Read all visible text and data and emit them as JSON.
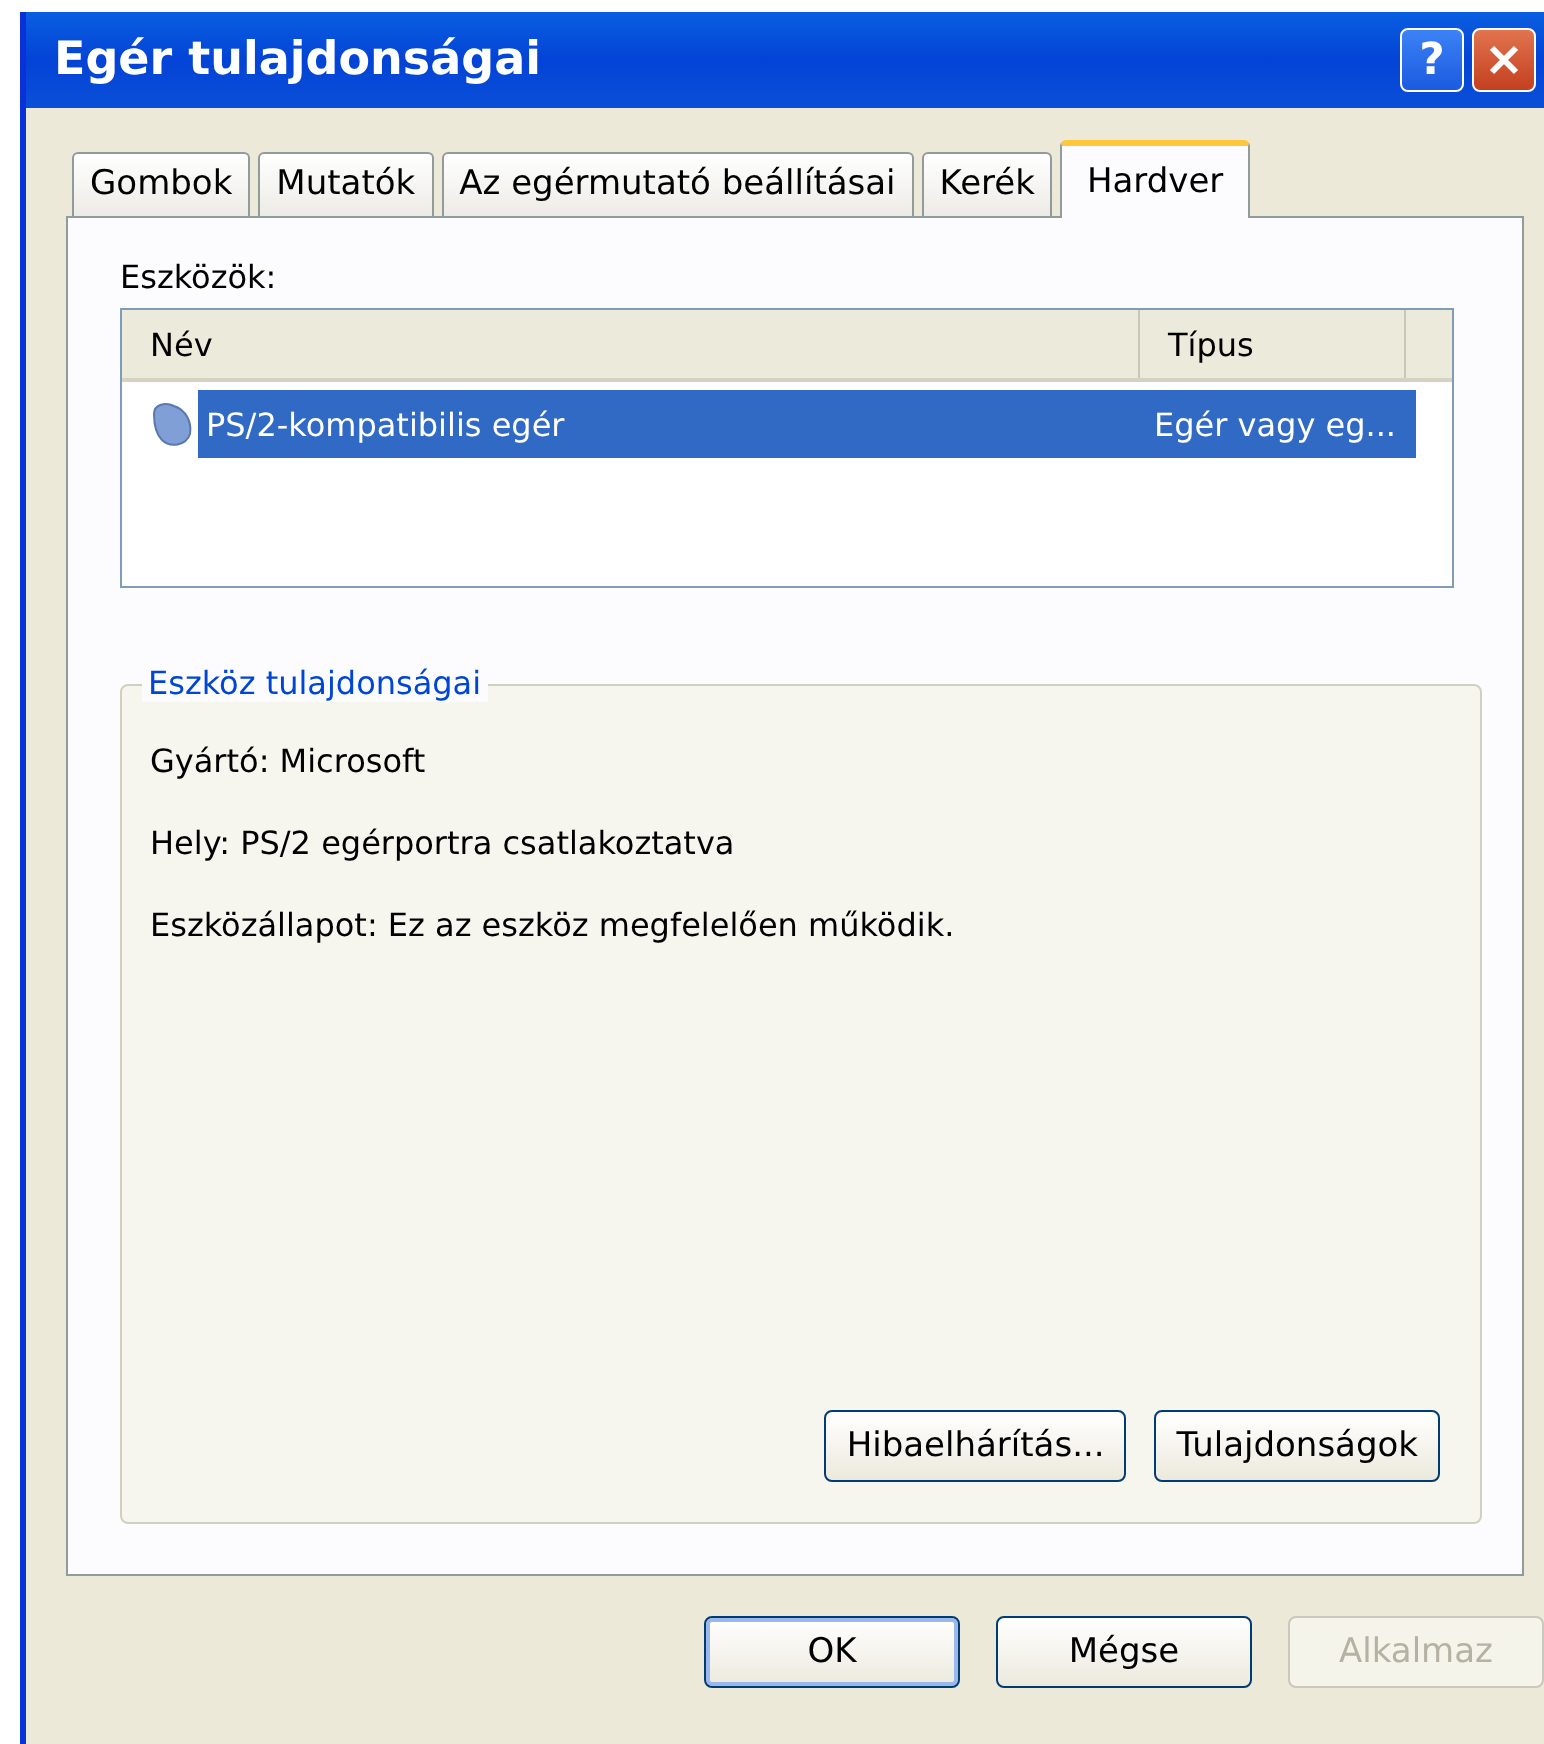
{
  "window": {
    "title": "Egér tulajdonságai",
    "help_button": "?"
  },
  "tabs": [
    {
      "label": "Gombok",
      "selected": false
    },
    {
      "label": "Mutatók",
      "selected": false
    },
    {
      "label": "Az egérmutató beállításai",
      "selected": false
    },
    {
      "label": "Kerék",
      "selected": false
    },
    {
      "label": "Hardver",
      "selected": true
    }
  ],
  "devices": {
    "label": "Eszközök:",
    "columns": [
      "Név",
      "Típus"
    ],
    "rows": [
      {
        "name": "PS/2-kompatibilis egér",
        "type": "Egér vagy eg...",
        "selected": true
      }
    ]
  },
  "properties": {
    "title": "Eszköz tulajdonságai",
    "lines": [
      "Gyártó: Microsoft",
      "Hely: PS/2 egérportra csatlakoztatva",
      "Eszközállapot: Ez az eszköz megfelelően működik."
    ],
    "buttons": [
      {
        "label": "Hibaelhárítás...",
        "disabled": false
      },
      {
        "label": "Tulajdonságok",
        "disabled": false
      }
    ]
  },
  "buttons": [
    {
      "label": "OK",
      "disabled": false,
      "default": true
    },
    {
      "label": "Mégse",
      "disabled": false,
      "default": false
    },
    {
      "label": "Alkalmaz",
      "disabled": true,
      "default": false
    }
  ]
}
